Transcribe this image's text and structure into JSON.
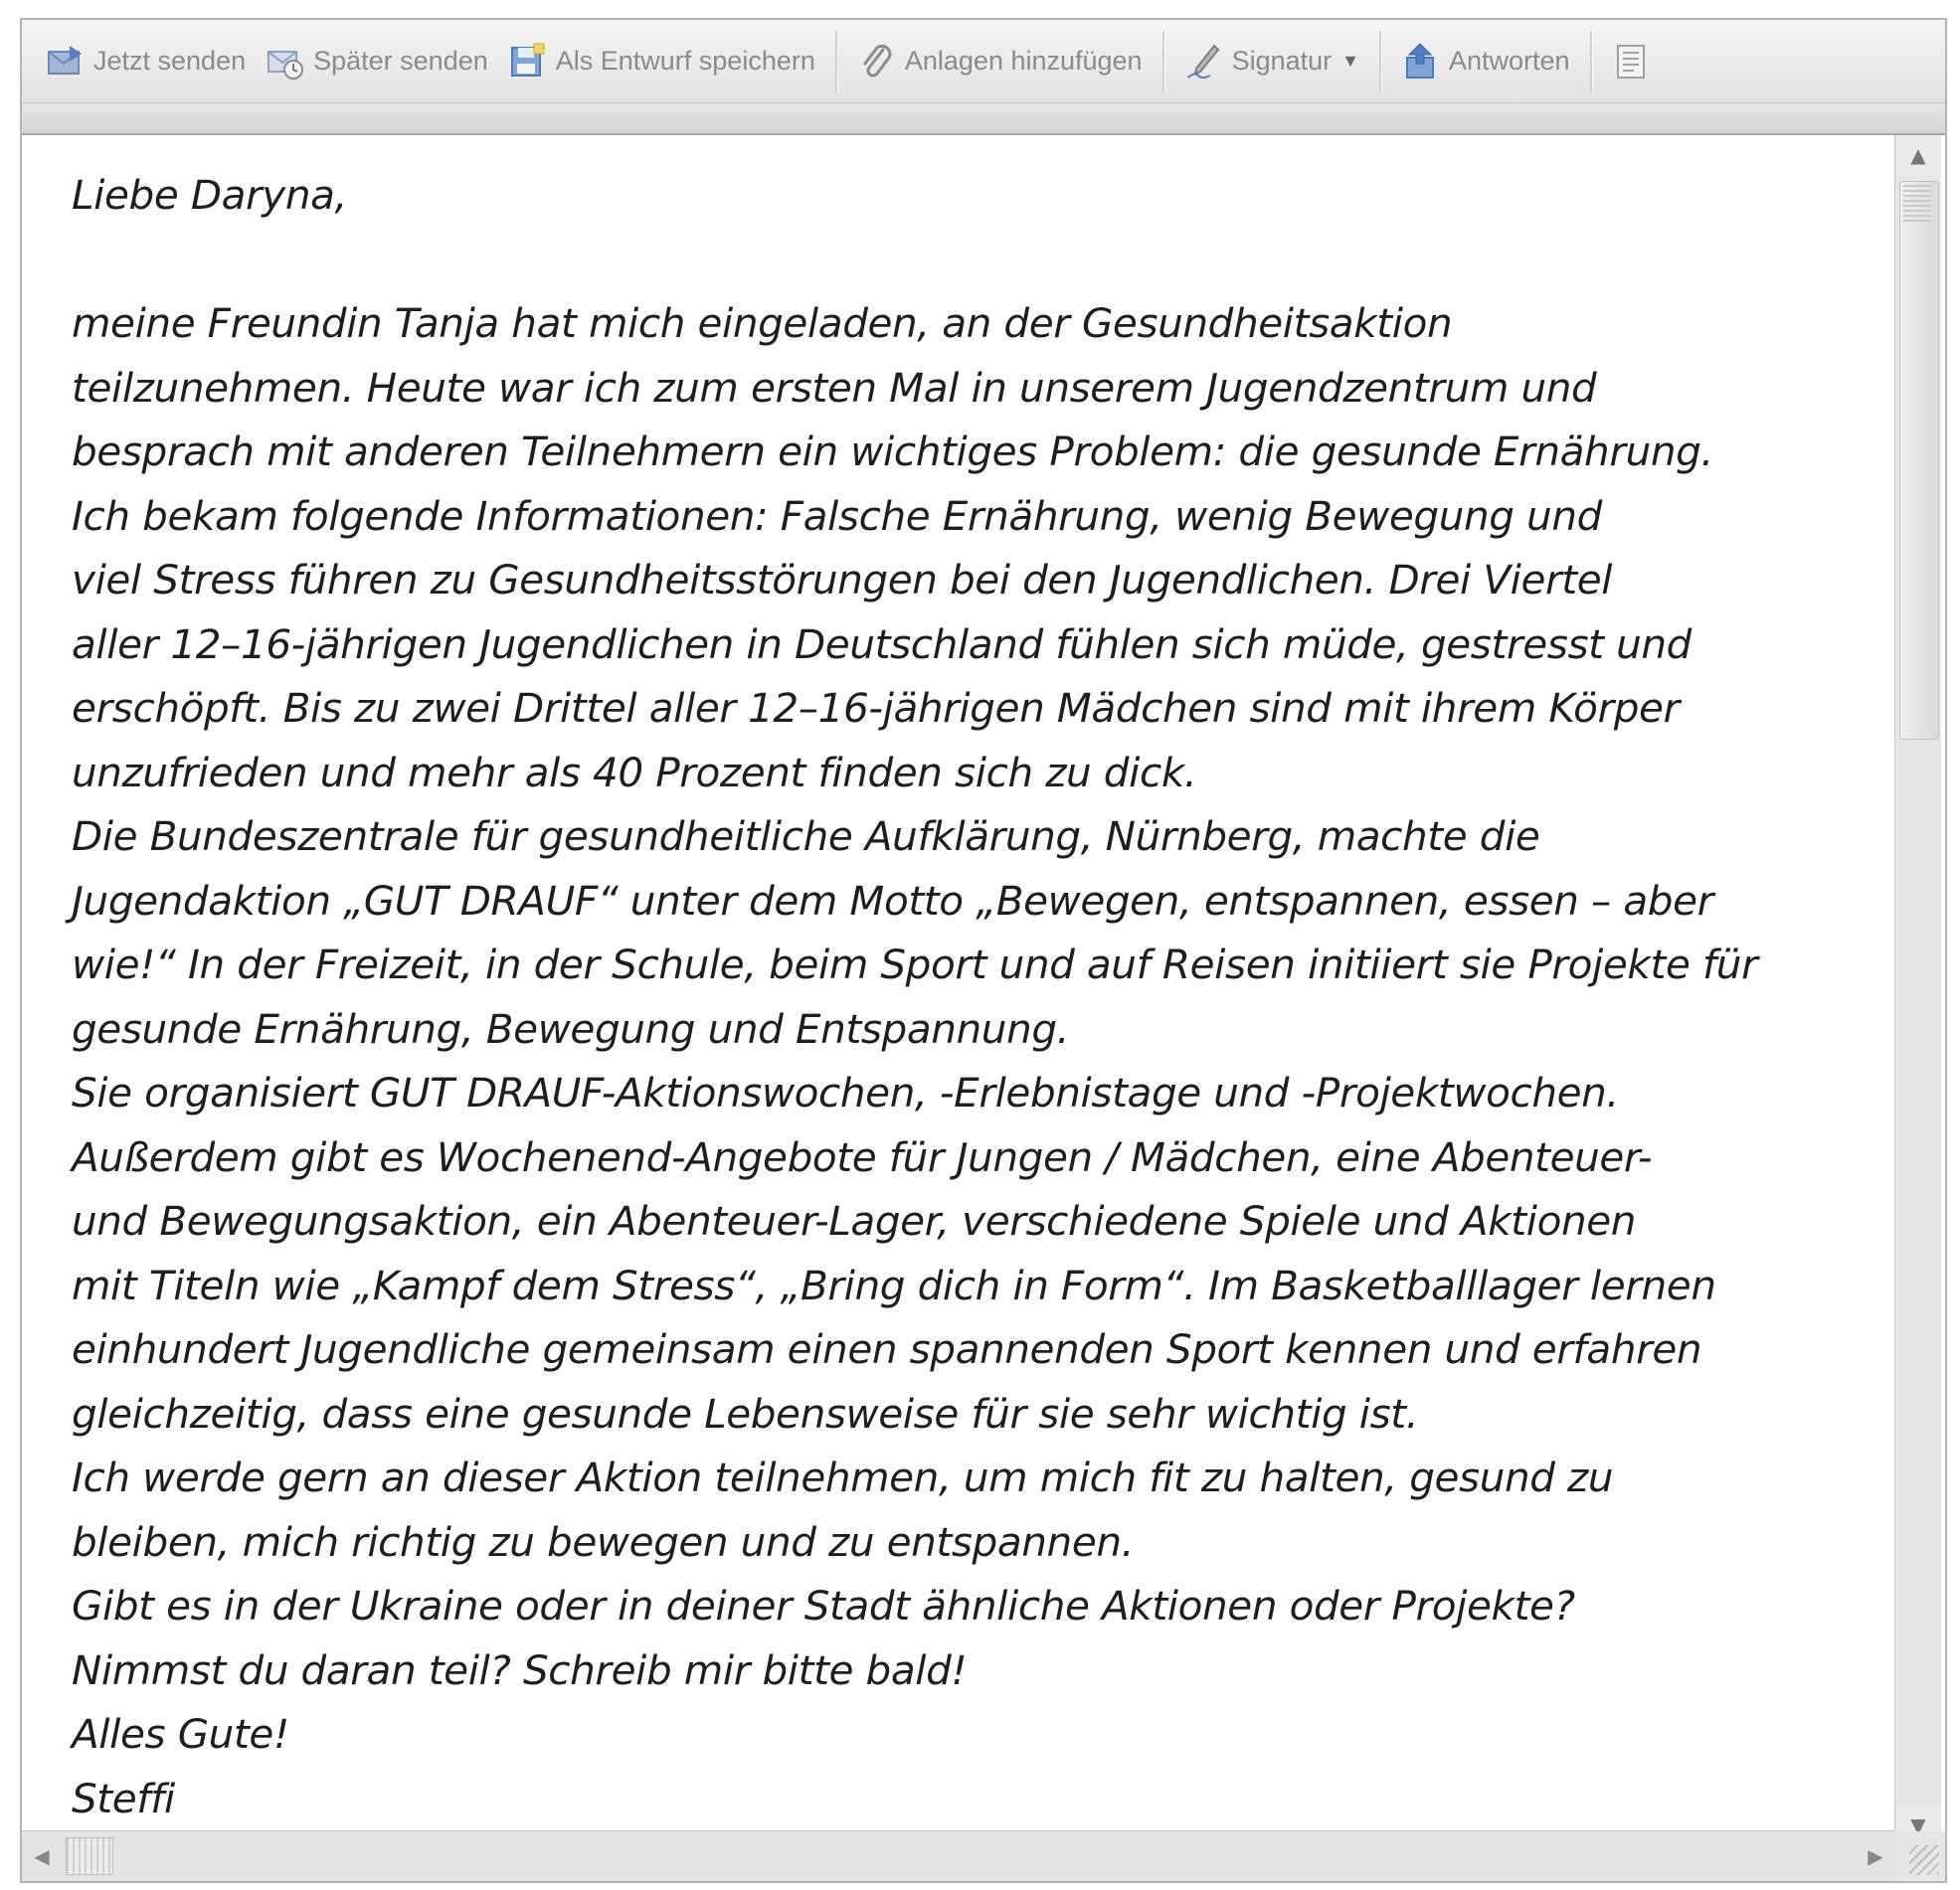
{
  "toolbar": {
    "send_now": "Jetzt senden",
    "send_later": "Später senden",
    "save_draft": "Als Entwurf speichern",
    "add_attachments": "Anlagen hinzufügen",
    "signature": "Signatur",
    "reply": "Antworten"
  },
  "icons": {
    "send_now": "send-now-icon",
    "send_later": "send-later-icon",
    "save_draft": "save-draft-icon",
    "attachment": "paperclip-icon",
    "signature": "pen-icon",
    "reply": "reply-icon",
    "options": "options-icon"
  },
  "message": {
    "lines": [
      "Liebe Daryna,",
      "",
      "meine Freundin Tanja hat mich eingeladen, an der Gesundheitsaktion",
      "teilzunehmen. Heute war ich zum ersten Mal in unserem Jugendzentrum und",
      "besprach mit anderen Teilnehmern ein wichtiges Problem: die gesunde Ernährung.",
      "Ich bekam folgende Informationen: Falsche Ernährung, wenig Bewegung und",
      "viel Stress führen zu Gesundheitsstörungen bei den Jugendlichen. Drei Viertel",
      "aller 12–16-jährigen Jugendlichen in Deutschland fühlen sich müde, gestresst und",
      "erschöpft. Bis zu zwei Drittel aller 12–16-jährigen Mädchen sind mit ihrem Körper",
      "unzufrieden und mehr als 40 Prozent finden sich zu dick.",
      "Die Bundeszentrale für gesundheitliche Aufklärung, Nürnberg, machte die",
      "Jugendaktion „GUT DRAUF“ unter dem Motto „Bewegen, entspannen, essen – aber",
      "wie!“ In der Freizeit, in der Schule, beim Sport und auf Reisen initiiert sie Projekte für",
      "gesunde Ernährung, Bewegung und Entspannung.",
      "Sie organisiert GUT DRAUF-Aktionswochen, -Erlebnistage und -Projektwochen.",
      "Außerdem gibt es Wochenend-Angebote für Jungen / Mädchen, eine Abenteuer-",
      "und Bewegungsaktion, ein Abenteuer-Lager, verschiedene Spiele und Aktionen",
      "mit Titeln wie „Kampf dem Stress“, „Bring dich in Form“. Im Basketballlager lernen",
      "einhundert Jugendliche gemeinsam einen spannenden Sport kennen und erfahren",
      "gleichzeitig, dass eine gesunde Lebensweise für sie sehr wichtig ist.",
      "Ich werde gern an dieser Aktion teilnehmen, um mich fit zu halten, gesund zu",
      "bleiben, mich richtig zu bewegen und zu entspannen.",
      "Gibt es in der Ukraine oder in deiner Stadt ähnliche Aktionen oder Projekte?",
      "Nimmst du daran teil? Schreib mir bitte bald!",
      "Alles Gute!",
      "Steffi"
    ]
  }
}
